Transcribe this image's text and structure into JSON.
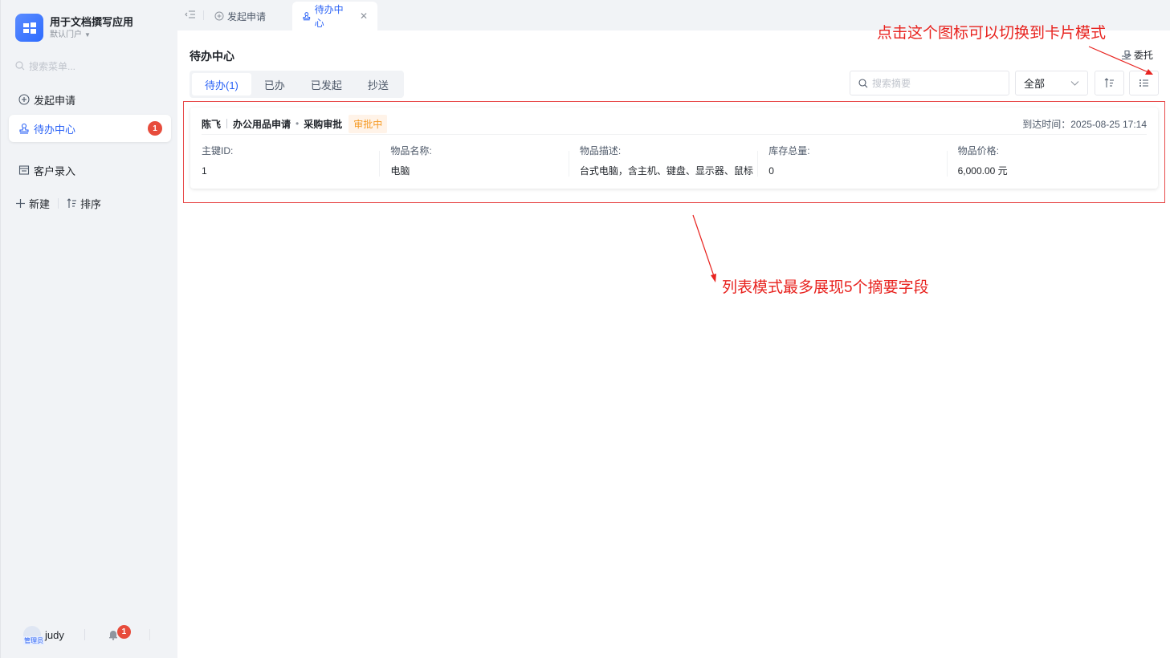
{
  "app": {
    "title": "用于文档撰写应用",
    "subtitle": "默认门户"
  },
  "sidebar": {
    "search_placeholder": "搜索菜单...",
    "items": [
      {
        "label": "发起申请"
      },
      {
        "label": "待办中心",
        "badge": "1"
      },
      {
        "label": "客户录入"
      }
    ],
    "new_label": "新建",
    "sort_label": "排序"
  },
  "user": {
    "name": "judy",
    "role_tag": "管理员",
    "notify_count": "1"
  },
  "tabs": [
    {
      "label": "发起申请"
    },
    {
      "label": "待办中心"
    }
  ],
  "main": {
    "title": "待办中心",
    "delegate_label": "委托",
    "segments": [
      "待办(1)",
      "已办",
      "已发起",
      "抄送"
    ],
    "search_placeholder": "搜索摘要",
    "filter_value": "全部"
  },
  "task": {
    "initiator": "陈飞",
    "form": "办公用品申请",
    "node": "采购审批",
    "status": "审批中",
    "arrival": "到达时间：2025-08-25 17:14",
    "fields": [
      {
        "label": "主键ID:",
        "value": "1"
      },
      {
        "label": "物品名称:",
        "value": "电脑"
      },
      {
        "label": "物品描述:",
        "value": "台式电脑，含主机、键盘、显示器、鼠标"
      },
      {
        "label": "库存总量:",
        "value": "0"
      },
      {
        "label": "物品价格:",
        "value": "6,000.00 元"
      }
    ]
  },
  "annotations": {
    "top": "点击这个图标可以切换到卡片模式",
    "middle": "列表模式最多展现5个摘要字段"
  },
  "colors": {
    "accent": "#2a62f6",
    "badge": "#e74c3c",
    "status": "#f59a23",
    "annotation": "#e8231f"
  }
}
